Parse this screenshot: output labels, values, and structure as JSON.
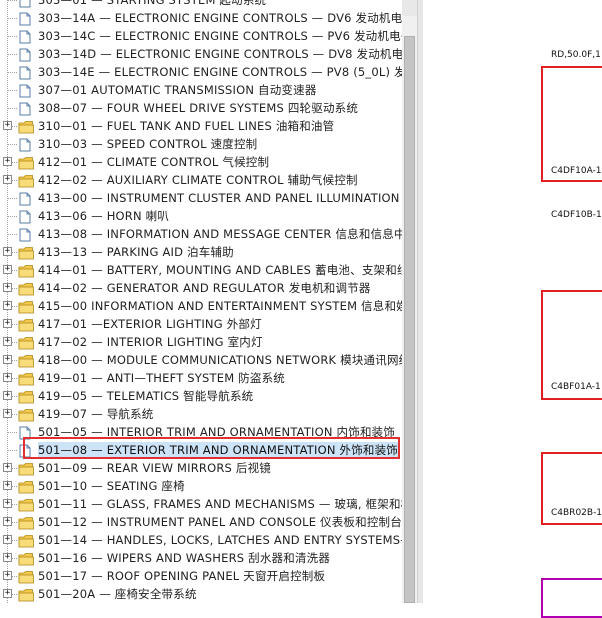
{
  "tree": {
    "items": [
      {
        "label": "303—01 — STARTING SYSTEM 起动系统",
        "expandable": false
      },
      {
        "label": "303—14A — ELECTRONIC ENGINE CONTROLS — DV6 发动机电子",
        "expandable": false
      },
      {
        "label": "303—14C — ELECTRONIC ENGINE CONTROLS — PV6 发动机电子",
        "expandable": false
      },
      {
        "label": "303—14D — ELECTRONIC ENGINE CONTROLS — DV8 发动机电子",
        "expandable": false
      },
      {
        "label": "303—14E — ELECTRONIC ENGINE CONTROLS — PV8 (5_0L) 发动",
        "expandable": false
      },
      {
        "label": "307—01 AUTOMATIC TRANSMISSION 自动变速器",
        "expandable": false
      },
      {
        "label": "308—07 — FOUR WHEEL DRIVE SYSTEMS 四轮驱动系统",
        "expandable": false
      },
      {
        "label": "310—01 — FUEL TANK AND FUEL LINES 油箱和油管",
        "expandable": true
      },
      {
        "label": "310—03 — SPEED CONTROL 速度控制",
        "expandable": false
      },
      {
        "label": "412—01 — CLIMATE CONTROL 气候控制",
        "expandable": true
      },
      {
        "label": "412—02 — AUXILIARY CLIMATE CONTROL 辅助气候控制",
        "expandable": true
      },
      {
        "label": "413—00 — INSTRUMENT CLUSTER AND PANEL ILLUMINATION 仪",
        "expandable": false
      },
      {
        "label": "413—06 — HORN 喇叭",
        "expandable": false
      },
      {
        "label": "413—08 — INFORMATION AND MESSAGE CENTER 信息和信息中心",
        "expandable": false
      },
      {
        "label": "413—13 — PARKING AID 泊车辅助",
        "expandable": true
      },
      {
        "label": "414—01 — BATTERY, MOUNTING AND CABLES 蓄电池、支架和线",
        "expandable": true
      },
      {
        "label": "414—02 — GENERATOR AND REGULATOR 发电机和调节器",
        "expandable": true
      },
      {
        "label": "415—00 INFORMATION AND ENTERTAINMENT SYSTEM 信息和娱乐",
        "expandable": true
      },
      {
        "label": "417—01 —EXTERIOR LIGHTING 外部灯",
        "expandable": true
      },
      {
        "label": "417—02 — INTERIOR LIGHTING 室内灯",
        "expandable": true
      },
      {
        "label": "418—00 — MODULE COMMUNICATIONS NETWORK 模块通讯网络",
        "expandable": true
      },
      {
        "label": "419—01 — ANTI—THEFT SYSTEM 防盗系统",
        "expandable": true
      },
      {
        "label": "419—05 — TELEMATICS 智能导航系统",
        "expandable": true
      },
      {
        "label": "419—07 — 导航系统",
        "expandable": true
      },
      {
        "label": "501—05 — INTERIOR TRIM AND ORNAMENTATION 内饰和装饰",
        "expandable": false
      },
      {
        "label": "501—08 — EXTERIOR TRIM AND ORNAMENTATION 外饰和装饰",
        "expandable": false,
        "selected": true
      },
      {
        "label": "501—09 — REAR VIEW MIRRORS 后视镜",
        "expandable": true
      },
      {
        "label": "501—10 — SEATING 座椅",
        "expandable": true
      },
      {
        "label": "501—11 — GLASS, FRAMES AND MECHANISMS — 玻璃, 框架和机",
        "expandable": true
      },
      {
        "label": "501—12 — INSTRUMENT PANEL AND CONSOLE 仪表板和控制台",
        "expandable": true
      },
      {
        "label": "501—14 — HANDLES, LOCKS, LATCHES AND ENTRY SYSTEMS—",
        "expandable": true
      },
      {
        "label": "501—16 — WIPERS AND WASHERS 刮水器和清洗器",
        "expandable": true
      },
      {
        "label": "501—17 — ROOF OPENING PANEL 天窗开启控制板",
        "expandable": true
      },
      {
        "label": "501—20A — 座椅安全带系统",
        "expandable": true
      }
    ]
  },
  "preview": {
    "header_label": "RD,50.0F,1",
    "labels": [
      "C4DF10A-1",
      "C4DF10B-1",
      "C4BF01A-1",
      "C4BR02B-1"
    ]
  },
  "colors": {
    "selection_outline": "#e03030",
    "selection_fill": "#cde3f7",
    "folder": "#f2c94c"
  }
}
